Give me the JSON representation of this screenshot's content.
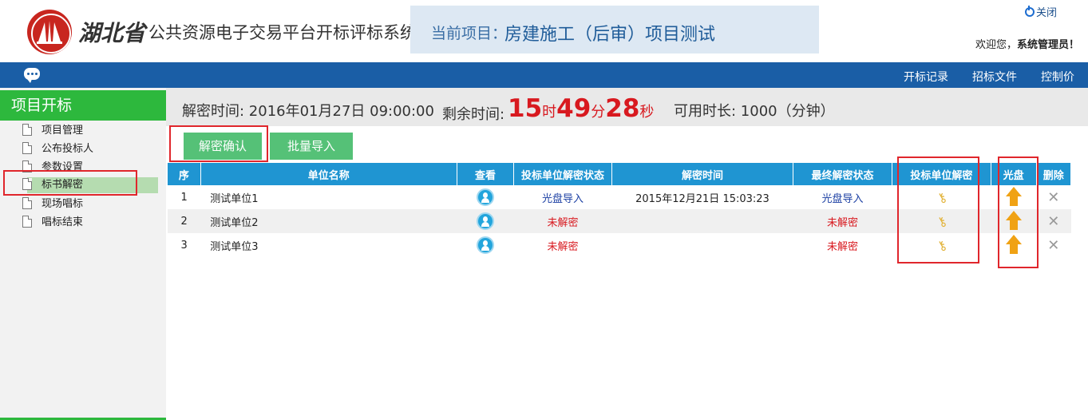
{
  "header": {
    "brand_main": "湖北省",
    "brand_sub": "公共资源电子交易平台开标评标系统",
    "project_label": "当前项目：",
    "project_name": "房建施工（后审）项目测试",
    "close_label": "关闭",
    "welcome": "欢迎您，",
    "user": "系统管理员！"
  },
  "nav": {
    "links": [
      "开标记录",
      "招标文件",
      "控制价"
    ]
  },
  "sidebar": {
    "title": "项目开标",
    "items": [
      {
        "label": "项目管理"
      },
      {
        "label": "公布投标人"
      },
      {
        "label": "参数设置"
      },
      {
        "label": "标书解密"
      },
      {
        "label": "现场唱标"
      },
      {
        "label": "唱标结束"
      }
    ]
  },
  "info": {
    "decrypt_time": "解密时间: 2016年01月27日 09:00:00",
    "remaining_label": "剩余时间:",
    "hours": "15",
    "hours_unit": "时",
    "minutes": "49",
    "minutes_unit": "分",
    "seconds": "28",
    "seconds_unit": "秒",
    "available": "可用时长: 1000（分钟）"
  },
  "buttons": {
    "confirm": "解密确认",
    "batch_import": "批量导入"
  },
  "table": {
    "headers": [
      "序",
      "单位名称",
      "查看",
      "投标单位解密状态",
      "解密时间",
      "最终解密状态",
      "投标单位解密",
      "光盘",
      "删除"
    ],
    "rows": [
      {
        "no": "1",
        "name": "测试单位1",
        "status": "光盘导入",
        "time": "2015年12月21日 15:03:23",
        "final": "光盘导入"
      },
      {
        "no": "2",
        "name": "测试单位2",
        "status": "未解密",
        "time": "",
        "final": "未解密"
      },
      {
        "no": "3",
        "name": "测试单位3",
        "status": "未解密",
        "time": "",
        "final": "未解密"
      }
    ]
  },
  "colors": {
    "nav_blue": "#1a5ea6",
    "green": "#2db83d",
    "table_header": "#1f95d2",
    "timer_red": "#d8191f",
    "highlight_red": "#e0262c"
  }
}
